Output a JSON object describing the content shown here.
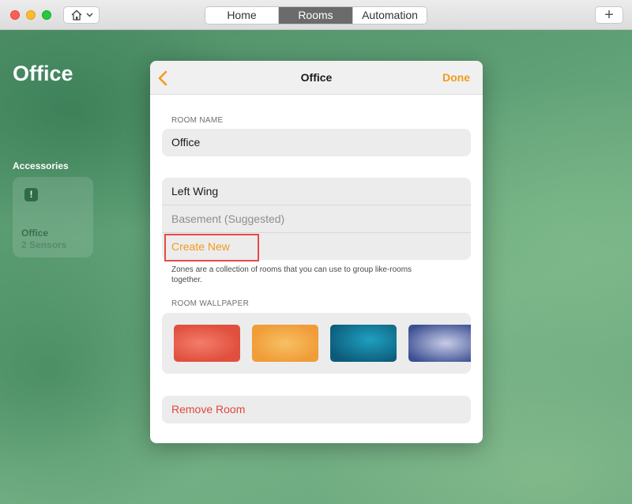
{
  "window": {
    "tabs": [
      "Home",
      "Rooms",
      "Automation"
    ],
    "selected_tab": "Rooms",
    "add_label": "+"
  },
  "background": {
    "room_title": "Office",
    "section_title": "Accessories",
    "tile": {
      "name": "Office",
      "subtitle": "2 Sensors",
      "badge": "!"
    }
  },
  "sheet": {
    "title": "Office",
    "done_label": "Done",
    "room_name_label": "ROOM NAME",
    "room_name_value": "Office",
    "zones": [
      "Left Wing",
      "Basement (Suggested)",
      "Create New"
    ],
    "zones_note": "Zones are a collection of rooms that you can use to group like-rooms together.",
    "wallpaper_label": "ROOM WALLPAPER",
    "remove_label": "Remove Room"
  },
  "colors": {
    "accent": "#f29a1e",
    "destructive": "#e0473c",
    "highlight": "#e64b45"
  }
}
